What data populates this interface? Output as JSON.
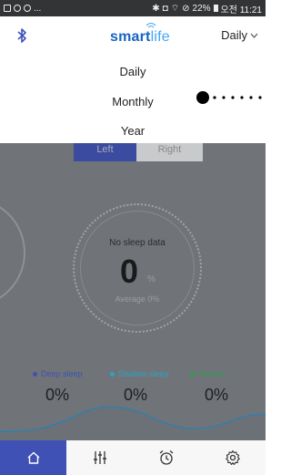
{
  "status_bar": {
    "left_more": "...",
    "battery": "22%",
    "time": "오전 11:21"
  },
  "app_bar": {
    "logo_bold": "smart",
    "logo_light": "life",
    "period_selected": "Daily"
  },
  "dropdown": {
    "options": [
      "Daily",
      "Monthly",
      "Year"
    ]
  },
  "segmented": {
    "left": "Left",
    "right": "Right"
  },
  "sleep": {
    "no_data": "No sleep data",
    "value": "0",
    "unit": "%",
    "average": "Average 0%"
  },
  "legend": [
    {
      "label": "Deep sleep",
      "value": "0%",
      "color": "#3f51b5"
    },
    {
      "label": "Shallow sleep",
      "value": "0%",
      "color": "#29a3c8"
    },
    {
      "label": "Torsion",
      "value": "0%",
      "color": "#2e9e4f"
    }
  ],
  "tabs": [
    {
      "icon": "home-icon",
      "active": true
    },
    {
      "icon": "sliders-icon",
      "active": false
    },
    {
      "icon": "alarm-clock-icon",
      "active": false
    },
    {
      "icon": "settings-gear-icon",
      "active": false
    }
  ],
  "colors": {
    "accent": "#3f51b5",
    "overlay": "#707478",
    "brand_blue": "#1565c0"
  }
}
